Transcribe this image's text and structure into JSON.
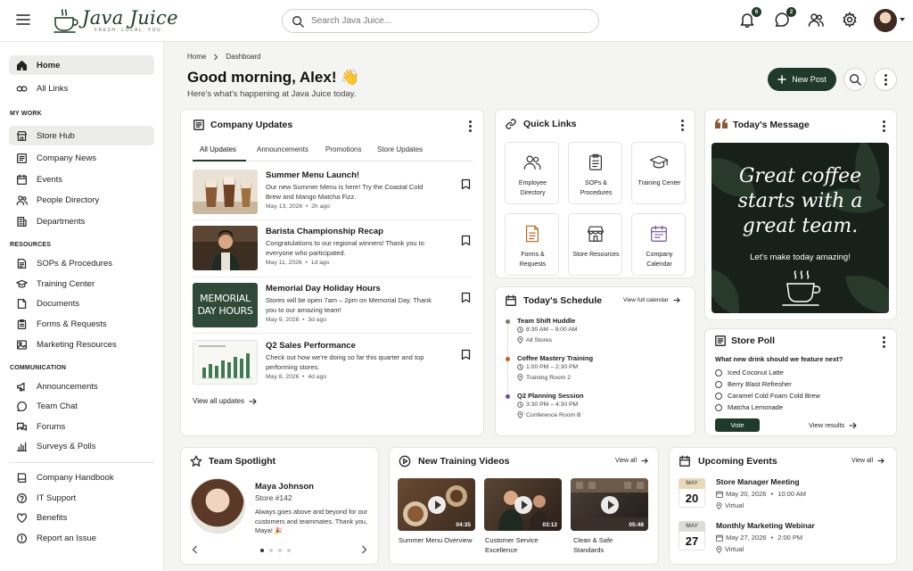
{
  "brand": {
    "name": "Java Juice",
    "tagline": "FRESH. LOCAL. YOU."
  },
  "search": {
    "placeholder": "Search Java Juice..."
  },
  "topbar": {
    "notifications_count": "6",
    "messages_count": "2"
  },
  "sidebar": {
    "top": [
      {
        "label": "Home"
      },
      {
        "label": "All Links"
      }
    ],
    "sections": [
      {
        "title": "MY WORK",
        "items": [
          "Store Hub",
          "Company News",
          "Events",
          "People Directory",
          "Departments"
        ]
      },
      {
        "title": "RESOURCES",
        "items": [
          "SOPs & Procedures",
          "Training Center",
          "Documents",
          "Forms & Requests",
          "Marketing Resources"
        ]
      },
      {
        "title": "COMMUNICATION",
        "items": [
          "Announcements",
          "Team Chat",
          "Forums",
          "Surveys & Polls"
        ]
      }
    ],
    "bottom": [
      "Company Handbook",
      "IT Support",
      "Benefits",
      "Report an Issue"
    ]
  },
  "breadcrumb": [
    "Home",
    "Dashboard"
  ],
  "header": {
    "greeting": "Good morning, Alex! 👋",
    "subtitle": "Here's what's happening at Java Juice today.",
    "new_post": "New Post"
  },
  "company_updates": {
    "title": "Company Updates",
    "tabs": [
      "All Updates",
      "Announcements",
      "Promotions",
      "Store Updates"
    ],
    "items": [
      {
        "title": "Summer Menu Launch!",
        "text": "Our new Summer Menu is here! Try the Coastal Cold Brew and Mango Matcha Fizz.",
        "date": "May 13, 2026",
        "ago": "2h ago"
      },
      {
        "title": "Barista Championship Recap",
        "text": "Congratulations to our regional winners! Thank you to everyone who participated.",
        "date": "May 11, 2026",
        "ago": "1d ago"
      },
      {
        "title": "Memorial Day Holiday Hours",
        "text": "Stores will be open 7am – 2pm on Memorial Day. Thank you to our amazing team!",
        "date": "May 9, 2026",
        "ago": "3d ago",
        "thumb_text": [
          "MEMORIAL",
          "DAY HOURS"
        ]
      },
      {
        "title": "Q2 Sales Performance",
        "text": "Check out how we're doing so far this quarter and top performing stores.",
        "date": "May 8, 2026",
        "ago": "4d ago"
      }
    ],
    "view_all": "View all updates"
  },
  "quick_links": {
    "title": "Quick Links",
    "items": [
      {
        "label": "Employee Directory",
        "icon": "people-icon"
      },
      {
        "label": "SOPs & Procedures",
        "icon": "clipboard-icon"
      },
      {
        "label": "Training Center",
        "icon": "graduation-cap-icon"
      },
      {
        "label": "Forms & Requests",
        "icon": "document-icon"
      },
      {
        "label": "Store Resources",
        "icon": "storefront-icon"
      },
      {
        "label": "Company Calendar",
        "icon": "calendar-icon"
      }
    ]
  },
  "schedule": {
    "title": "Today's Schedule",
    "view_full": "View full calendar",
    "items": [
      {
        "title": "Team Shift Huddle",
        "time": "8:30 AM – 9:00 AM",
        "place": "All Stores",
        "color": "#7a7a70"
      },
      {
        "title": "Coffee Mastery Training",
        "time": "1:00 PM – 2:30 PM",
        "place": "Training Room 2",
        "color": "#b5651d"
      },
      {
        "title": "Q2 Planning Session",
        "time": "3:30 PM – 4:30 PM",
        "place": "Conference Room B",
        "color": "#6b4fa0"
      }
    ]
  },
  "todays_message": {
    "title": "Today's Message",
    "quote": "Great coffee starts with a great team.",
    "subtitle": "Let's make today amazing!"
  },
  "store_poll": {
    "title": "Store Poll",
    "question": "What new drink should we feature next?",
    "options": [
      "Iced Coconut Latte",
      "Berry Blast Refresher",
      "Caramel Cold Foam Cold Brew",
      "Matcha Lemonade"
    ],
    "vote": "Vote",
    "view_results": "View results"
  },
  "team_spotlight": {
    "title": "Team Spotlight",
    "name": "Maya Johnson",
    "store": "Store #142",
    "text": "Always goes above and beyond for our customers and teammates. Thank you, Maya! 🎉"
  },
  "training_videos": {
    "title": "New Training Videos",
    "view_all": "View all",
    "items": [
      {
        "label": "Summer Menu Overview",
        "duration": "04:35"
      },
      {
        "label": "Customer Service Excellence",
        "duration": "03:12"
      },
      {
        "label": "Clean & Safe Standards",
        "duration": "05:48"
      }
    ]
  },
  "upcoming_events": {
    "title": "Upcoming Events",
    "view_all": "View all",
    "items": [
      {
        "month": "MAY",
        "day": "20",
        "title": "Store Manager Meeting",
        "date": "May 20, 2026",
        "time": "10:00 AM",
        "location": "Virtual"
      },
      {
        "month": "MAY",
        "day": "27",
        "title": "Monthly Marketing Webinar",
        "date": "May 27, 2026",
        "time": "2:00 PM",
        "location": "Virtual"
      }
    ]
  },
  "colors": {
    "brand_green": "#1f3a2a",
    "page_bg": "#f4f4f2"
  }
}
